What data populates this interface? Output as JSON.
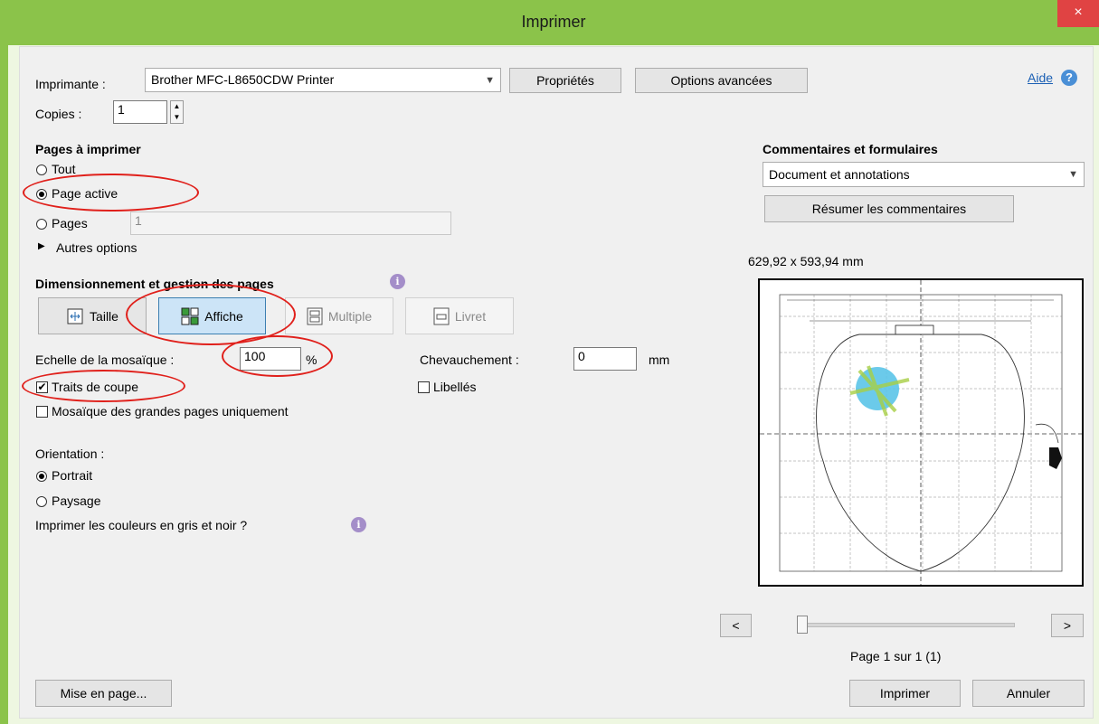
{
  "window": {
    "title": "Imprimer",
    "close_label": "×"
  },
  "printer": {
    "label": "Imprimante :",
    "value": "Brother MFC-L8650CDW Printer",
    "properties": "Propriétés",
    "advanced": "Options avancées"
  },
  "help": {
    "label": "Aide",
    "icon": "help-icon"
  },
  "copies": {
    "label": "Copies :",
    "value": "1"
  },
  "pages": {
    "title": "Pages à imprimer",
    "all": "Tout",
    "active": "Page active",
    "pages": "Pages",
    "pages_value": "1",
    "more": "Autres options",
    "selected": "active"
  },
  "sizing": {
    "title": "Dimensionnement et gestion des pages",
    "modes": [
      {
        "label": "Taille",
        "icon": "resize-icon",
        "state": "normal"
      },
      {
        "label": "Affiche",
        "icon": "poster-icon",
        "state": "active"
      },
      {
        "label": "Multiple",
        "icon": "multiple-pages-icon",
        "state": "disabled"
      },
      {
        "label": "Livret",
        "icon": "booklet-icon",
        "state": "disabled"
      }
    ]
  },
  "tile": {
    "scale_label": "Echelle de la mosaïque :",
    "scale_value": "100",
    "scale_unit": "%",
    "overlap_label": "Chevauchement :",
    "overlap_value": "0",
    "overlap_unit": "mm",
    "cut_marks": "Traits de coupe",
    "cut_marks_checked": true,
    "labels": "Libellés",
    "labels_checked": false,
    "large_only": "Mosaïque des grandes pages uniquement",
    "large_only_checked": false
  },
  "orientation": {
    "label": "Orientation :",
    "portrait": "Portrait",
    "landscape": "Paysage",
    "selected": "portrait"
  },
  "grayscale": {
    "label": "Imprimer les couleurs en gris et noir ?"
  },
  "comments": {
    "title": "Commentaires et formulaires",
    "value": "Document et annotations",
    "summarize": "Résumer les commentaires"
  },
  "preview": {
    "dimensions": "629,92 x 593,94 mm",
    "page_info": "Page 1 sur 1 (1)",
    "prev": "<",
    "next": ">"
  },
  "footer": {
    "page_setup": "Mise en page...",
    "print": "Imprimer",
    "cancel": "Annuler"
  },
  "colors": {
    "titlebar": "#8bc34a",
    "highlight": "#e0201b",
    "active_mode": "#cce4f7",
    "link": "#1a5fb4"
  }
}
